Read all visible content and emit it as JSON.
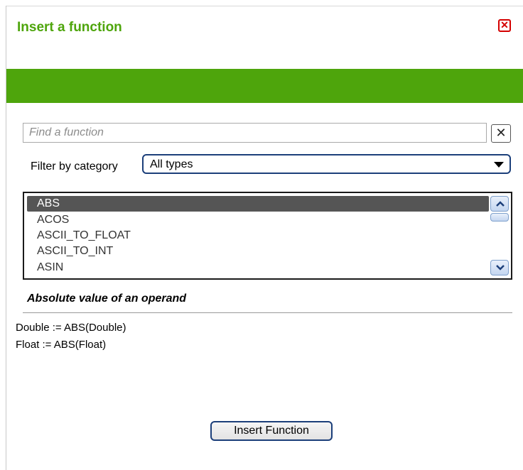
{
  "dialog": {
    "title": "Insert a function",
    "close_icon": "close-icon",
    "accent_color": "#4ea50c"
  },
  "search": {
    "value": "",
    "placeholder": "Find a function",
    "clear_label": "✕"
  },
  "filter": {
    "label": "Filter by category",
    "selected": "All types"
  },
  "functions": {
    "items": [
      "ABS",
      "ACOS",
      "ASCII_TO_FLOAT",
      "ASCII_TO_INT",
      "ASIN"
    ],
    "selected_index": 0
  },
  "details": {
    "description": "Absolute value of an operand",
    "syntax": [
      "Double := ABS(Double)",
      "Float := ABS(Float)"
    ]
  },
  "actions": {
    "insert_label": "Insert Function"
  }
}
